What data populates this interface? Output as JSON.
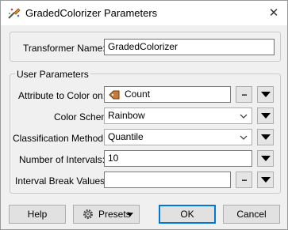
{
  "window": {
    "title": "GradedColorizer Parameters",
    "app_icon": "fme-transformer-icon",
    "close_glyph": "✕"
  },
  "transformer": {
    "name_label": "Transformer Name:",
    "name_value": "GradedColorizer"
  },
  "user_parameters": {
    "group_label": "User Parameters",
    "attribute": {
      "label": "Attribute to Color on:",
      "value": "Count",
      "icon": "attribute-icon",
      "ellipsis": "..."
    },
    "color_scheme": {
      "label": "Color Scheme:",
      "value": "Rainbow"
    },
    "classification": {
      "label": "Classification Method:",
      "value": "Quantile"
    },
    "intervals": {
      "label": "Number of Intervals:",
      "value": "10"
    },
    "break_values": {
      "label": "Interval Break Values:",
      "value": "",
      "ellipsis": "..."
    }
  },
  "buttons": {
    "help": "Help",
    "presets": "Presets",
    "ok": "OK",
    "cancel": "Cancel"
  },
  "colors": {
    "accent": "#0078d7",
    "attr_icon_fill": "#c77a3a"
  }
}
